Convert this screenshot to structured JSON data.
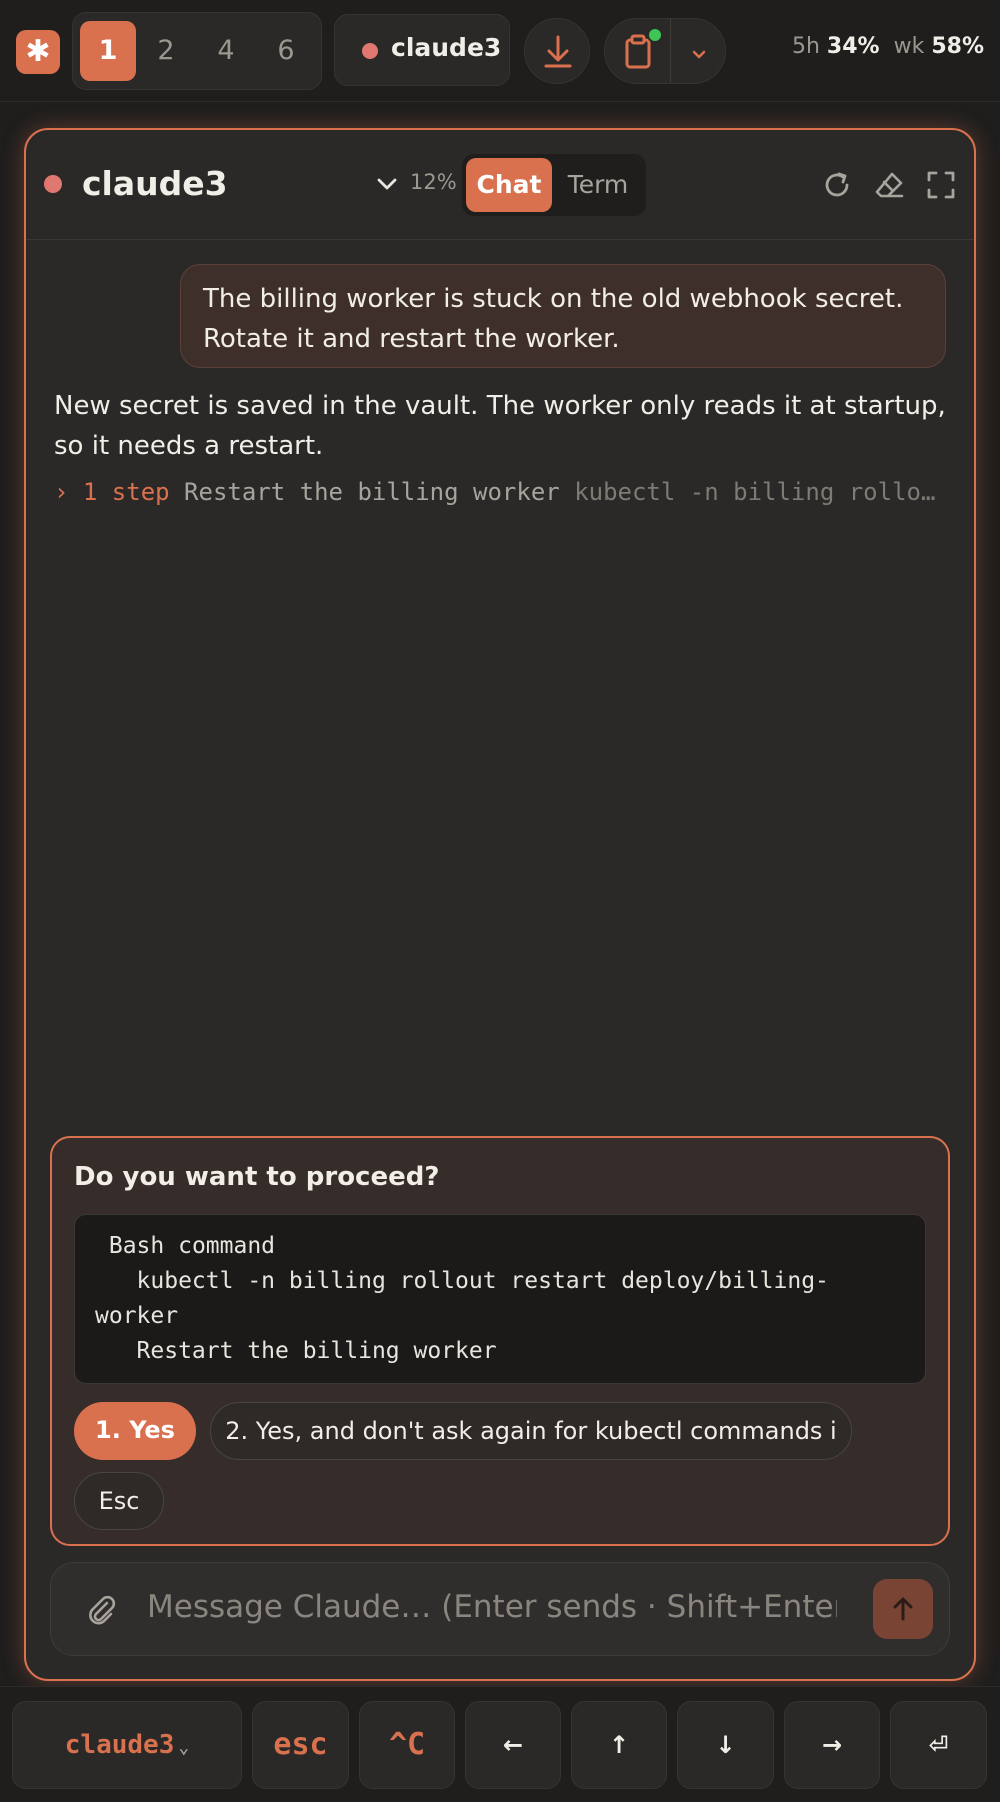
{
  "topbar": {
    "logo_glyph": "✱",
    "sessions": [
      "1",
      "2",
      "4",
      "6"
    ],
    "active_session": "1",
    "current_name": "claude3",
    "usage_5h_label": "5h",
    "usage_5h_value": "34%",
    "usage_wk_label": "wk",
    "usage_wk_value": "58%"
  },
  "panel": {
    "title": "claude3",
    "context_percent": "12%",
    "tab_chat": "Chat",
    "tab_term": "Term"
  },
  "conversation": {
    "user_message": "The billing worker is stuck on the old webhook secret. Rotate it and restart the worker.",
    "assistant_message": "New secret is saved in the vault. The worker only reads it at startup, so it needs a restart.",
    "step_prefix": "› 1 step",
    "step_title": "Restart the billing worker",
    "step_command": "kubectl -n billing rollo…"
  },
  "permission": {
    "question": "Do you want to proceed?",
    "code_block": " Bash command\n   kubectl -n billing rollout restart deploy/billing-worker\n   Restart the billing worker",
    "option_yes": "1. Yes",
    "option_yes_always": "2. Yes, and don't ask again for kubectl commands i",
    "option_esc": "Esc"
  },
  "composer": {
    "placeholder": "Message Claude… (Enter sends · Shift+Enter"
  },
  "keys": {
    "session_key": "claude3",
    "session_chevron": "⌄",
    "esc": "esc",
    "ctrl_c": "^C",
    "left": "←",
    "up": "↑",
    "down": "↓",
    "right": "→",
    "enter": "⏎"
  },
  "colors": {
    "accent": "#d9714f",
    "status_dot": "#e07870",
    "online_dot": "#3fc456",
    "background": "#1f1e1d",
    "panel": "#2a2927"
  }
}
